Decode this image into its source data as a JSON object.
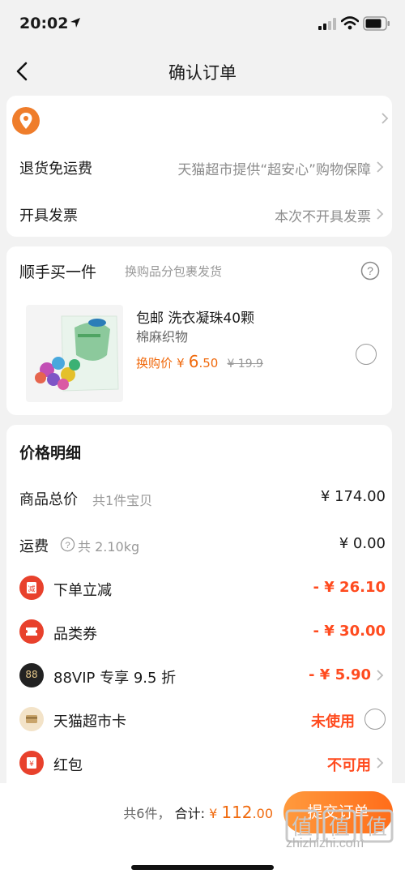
{
  "status": {
    "time": "20:02"
  },
  "nav": {
    "title": "确认订单"
  },
  "returns": {
    "label": "退货免运费",
    "value": "天猫超市提供“超安心”购物保障"
  },
  "invoice": {
    "label": "开具发票",
    "value": "本次不开具发票"
  },
  "addon": {
    "title": "顺手买一件",
    "subtitle": "换购品分包裹发货",
    "product": {
      "name": "包邮 洗衣凝珠40颗",
      "category": "棉麻织物",
      "price_label": "换购价",
      "currency": "¥",
      "price_int": "6",
      "price_dec": ".50",
      "original_price": "¥ 19.9"
    }
  },
  "pricing": {
    "title": "价格明细",
    "goods_total": {
      "label": "商品总价",
      "sub": "共1件宝贝",
      "value": "¥ 174.00"
    },
    "shipping": {
      "label": "运费",
      "sub": "共 2.10kg",
      "value": "¥ 0.00"
    },
    "instant_discount": {
      "label": "下单立减",
      "value": "- ¥ 26.10",
      "icon": "discount-icon"
    },
    "category_coupon": {
      "label": "品类券",
      "value": "- ¥ 30.00",
      "icon": "coupon-icon"
    },
    "vip": {
      "label": "88VIP 专享 9.5 折",
      "value": "- ¥ 5.90",
      "icon": "88vip-icon",
      "badge": "88"
    },
    "supermarket_card": {
      "label": "天猫超市卡",
      "value": "未使用",
      "icon": "card-icon"
    },
    "red_packet": {
      "label": "红包",
      "value": "不可用",
      "icon": "red-packet-icon"
    }
  },
  "footer": {
    "count": "共6件，",
    "total_label": "合计:",
    "currency": "¥",
    "total_int": "112",
    "total_dec": ".00",
    "submit": "提交订单"
  },
  "watermark": {
    "text": "zhizhizhi.com",
    "glyph": "值"
  },
  "colors": {
    "accent": "#f06a0e",
    "discount": "#ff4b1f",
    "button": "#ff7a22",
    "pin": "#ef7d2b"
  }
}
